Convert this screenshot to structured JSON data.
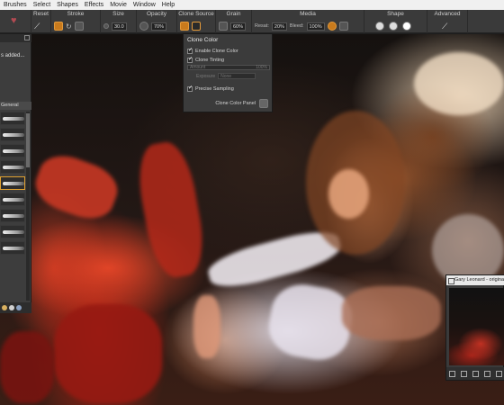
{
  "menu": [
    "Brushes",
    "Select",
    "Shapes",
    "Effects",
    "Movie",
    "Window",
    "Help"
  ],
  "propbar": {
    "reset": "Reset",
    "stroke": "Stroke",
    "size": "Size",
    "size_value": "30.0",
    "opacity": "Opacity",
    "opacity_value": "70%",
    "clone_source": "Clone Source",
    "grain": "Grain",
    "grain_value": "60%",
    "media": "Media",
    "resat_label": "Resat:",
    "resat_value": "20%",
    "bleed_label": "Bleed:",
    "bleed_value": "100%",
    "shape": "Shape",
    "advanced": "Advanced"
  },
  "clone_popup": {
    "title": "Clone Color",
    "enable_clone_color": "Enable Clone Color",
    "enable_checked": true,
    "clone_tinting": "Clone Tinting",
    "tinting_checked": true,
    "amount_label": "Amount",
    "amount_value": "100%",
    "exposure_label": "Exposure",
    "exposure_value": "None",
    "precise_sampling": "Precise Sampling",
    "precise_checked": true,
    "panel_button": "Clone Color Panel"
  },
  "brush_panel": {
    "added_text": "s added...",
    "category": "General",
    "brush_count": 9,
    "selected_index": 4
  },
  "navigator": {
    "title": "Gary Leonard - originalJ"
  },
  "colors": {
    "accent": "#c87a1c",
    "menubar_bg": "#f0f0f0",
    "propbar_bg": "#3a3a3a"
  }
}
